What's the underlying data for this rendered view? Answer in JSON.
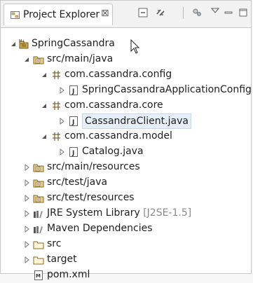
{
  "view": {
    "title": "Project Explorer",
    "close_glyph": "⊠"
  },
  "tree": {
    "items": [
      {
        "label": "SpringCassandra"
      },
      {
        "label": "src/main/java"
      },
      {
        "label": "com.cassandra.config"
      },
      {
        "label": "SpringCassandraApplicationConfig"
      },
      {
        "label": "com.cassandra.core"
      },
      {
        "label": "CassandraClient.java"
      },
      {
        "label": "com.cassandra.model"
      },
      {
        "label": "Catalog.java"
      },
      {
        "label": "src/main/resources"
      },
      {
        "label": "src/test/java"
      },
      {
        "label": "src/test/resources"
      },
      {
        "label": "JRE System Library",
        "decoration": "[J2SE-1.5]"
      },
      {
        "label": "Maven Dependencies"
      },
      {
        "label": "src"
      },
      {
        "label": "target"
      },
      {
        "label": "pom.xml"
      }
    ]
  },
  "colors": {
    "selection": "#e6eef7",
    "package_icon": "#8a6a2a",
    "folder_icon": "#c9a44a"
  }
}
